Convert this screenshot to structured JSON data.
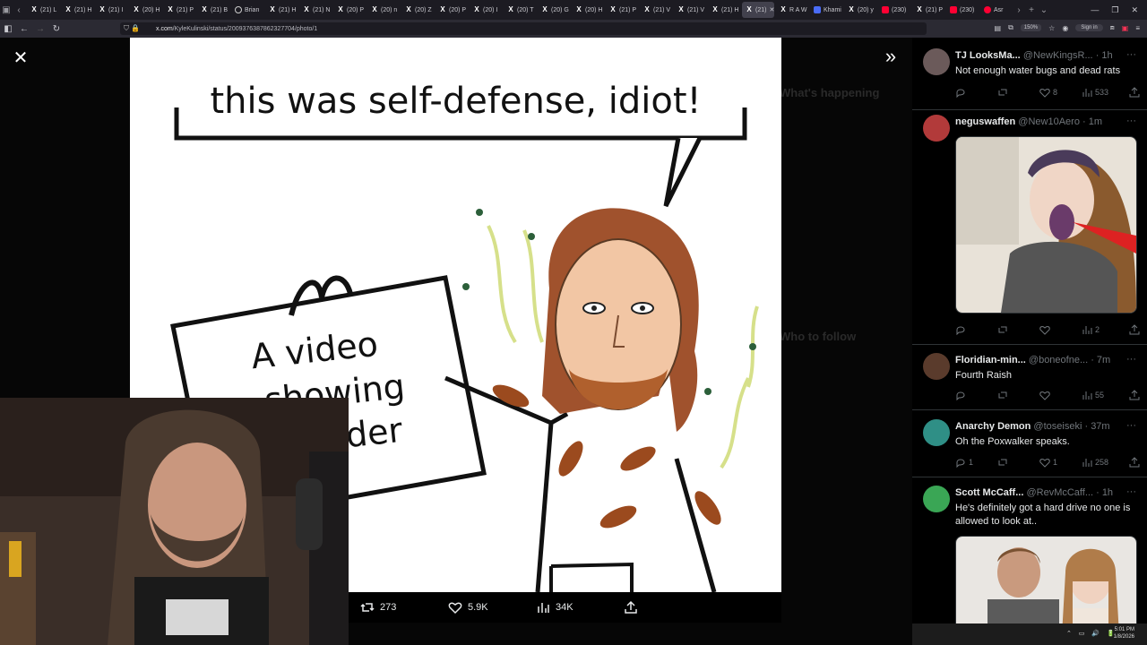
{
  "browser": {
    "tabs": [
      {
        "label": "(21) L",
        "icon": "x-logo"
      },
      {
        "label": "(21) H",
        "icon": "x-logo"
      },
      {
        "label": "(21) I",
        "icon": "x-logo"
      },
      {
        "label": "(20) H",
        "icon": "x-logo"
      },
      {
        "label": "(21) P",
        "icon": "x-logo"
      },
      {
        "label": "(21) B",
        "icon": "x-logo"
      },
      {
        "label": "Brian",
        "icon": "globe"
      },
      {
        "label": "(21) H",
        "icon": "x-logo"
      },
      {
        "label": "(21) N",
        "icon": "x-logo"
      },
      {
        "label": "(20) P",
        "icon": "x-logo"
      },
      {
        "label": "(20) n",
        "icon": "x-logo"
      },
      {
        "label": "(20) Z",
        "icon": "x-logo"
      },
      {
        "label": "(20) P",
        "icon": "x-logo"
      },
      {
        "label": "(20) I",
        "icon": "x-logo"
      },
      {
        "label": "(20) T",
        "icon": "x-logo"
      },
      {
        "label": "(20) G",
        "icon": "x-logo"
      },
      {
        "label": "(20) H",
        "icon": "x-logo"
      },
      {
        "label": "(21) P",
        "icon": "x-logo"
      },
      {
        "label": "(21) V",
        "icon": "x-logo"
      },
      {
        "label": "(21) V",
        "icon": "x-logo"
      },
      {
        "label": "(21) H",
        "icon": "x-logo"
      },
      {
        "label": "(21)",
        "icon": "x-logo",
        "active": true
      },
      {
        "label": "R A W",
        "icon": "x-logo"
      },
      {
        "label": "Khami",
        "icon": "blue"
      },
      {
        "label": "(20) y",
        "icon": "x-logo"
      },
      {
        "label": "(230)",
        "icon": "youtube"
      },
      {
        "label": "(21) P",
        "icon": "x-logo"
      },
      {
        "label": "(230)",
        "icon": "youtube"
      },
      {
        "label": "Asr",
        "icon": "red"
      }
    ],
    "url_host": "x.com",
    "url_path": "/KyleKulinski/status/2009376387862327704/photo/1",
    "zoom": "150%",
    "signin_label": "Sign in"
  },
  "viewer": {
    "meme_title": "this was self-defense, idiot!",
    "sign_lines": [
      "A video",
      "showing",
      "murder"
    ],
    "retweets": "273",
    "likes": "5.9K",
    "views": "34K"
  },
  "background_sidebar": {
    "happening": "What's happening",
    "who_to_follow": "Who to follow"
  },
  "feed": [
    {
      "name": "TJ LooksMa...",
      "handle": "@NewKingsR...",
      "time": "1h",
      "text": "Not enough water bugs and dead rats",
      "replies": "",
      "reposts": "",
      "likes": "8",
      "views": "533",
      "avatar_color": "#6b5a5a"
    },
    {
      "name": "neguswaffen",
      "handle": "@New10Aero",
      "time": "1m",
      "text": "",
      "replies": "",
      "reposts": "",
      "likes": "",
      "views": "2",
      "avatar_color": "#b23a3a"
    },
    {
      "name": "Floridian-min...",
      "handle": "@boneofne...",
      "time": "7m",
      "text": "Fourth Raish",
      "replies": "",
      "reposts": "",
      "likes": "",
      "views": "55",
      "avatar_color": "#5a3b2c"
    },
    {
      "name": "Anarchy Demon",
      "handle": "@toseiseki",
      "time": "37m",
      "text": "Oh the Poxwalker speaks.",
      "replies": "1",
      "reposts": "",
      "likes": "1",
      "views": "258",
      "avatar_color": "#2f8f86"
    },
    {
      "name": "Scott McCaff...",
      "handle": "@RevMcCaff...",
      "time": "1h",
      "text": "He's definitely got a hard drive no one is allowed to look at..",
      "replies": "",
      "reposts": "",
      "likes": "",
      "views": "",
      "avatar_color": "#3aa655"
    }
  ],
  "taskbar": {
    "time": "5:01 PM",
    "date": "1/8/2026"
  },
  "colors": {
    "page_bg": "#000000",
    "text": "#e7e9ea",
    "muted": "#71767b",
    "divider": "#2f3336",
    "browser_chrome": "#1c1b22"
  }
}
